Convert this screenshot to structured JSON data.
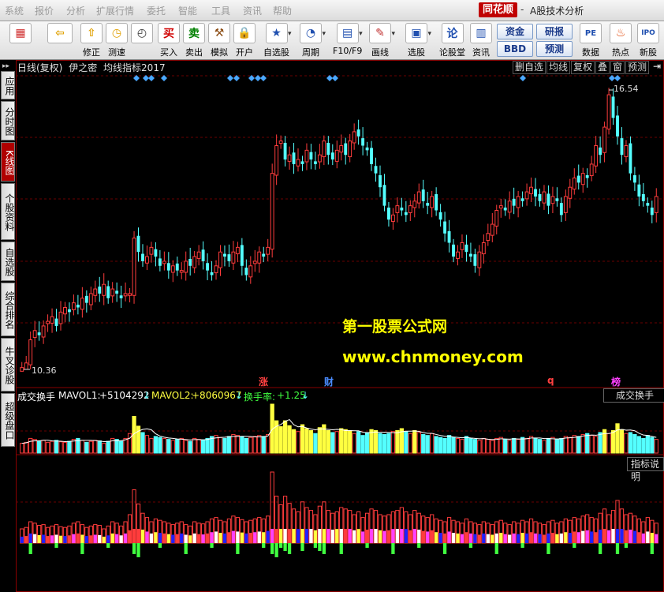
{
  "menu": [
    "系统",
    "报价",
    "分析",
    "扩展行情",
    "委托",
    "智能",
    "工具",
    "资讯",
    "帮助"
  ],
  "brand": "同花顺",
  "brand_dash": "-",
  "app_title": "A股技术分析",
  "toolbar": [
    {
      "label": "",
      "icon": "▦"
    },
    {
      "label": "",
      "icon": "⇦"
    },
    {
      "label": "修正",
      "icon": "⇧"
    },
    {
      "label": "测速",
      "icon": "◷"
    },
    {
      "label": "买入",
      "icon": "买"
    },
    {
      "label": "卖出",
      "icon": "卖"
    },
    {
      "label": "模拟",
      "icon": "⚒"
    },
    {
      "label": "开户",
      "icon": "🔒"
    },
    {
      "label": "自选股",
      "icon": "★"
    },
    {
      "label": "周期",
      "icon": "◔"
    },
    {
      "label": "F10/F9",
      "icon": "▤"
    },
    {
      "label": "画线",
      "icon": "✎"
    },
    {
      "label": "选股",
      "icon": "▣"
    },
    {
      "label": "论股堂",
      "icon": "论"
    },
    {
      "label": "资讯",
      "icon": "▥"
    },
    {
      "label": "数据",
      "icon": "PE"
    },
    {
      "label": "热点",
      "icon": "♨"
    },
    {
      "label": "新股",
      "icon": "IPO"
    }
  ],
  "toolbar_small": [
    "资金",
    "研报",
    "BBD",
    "预测"
  ],
  "sidebar": [
    "应用",
    "分时图",
    "K线图",
    "个股资料",
    "自选股",
    "综合排名",
    "牛叉诊股",
    "超级盘口"
  ],
  "chart_header": {
    "period": "日线(复权)",
    "stock": "伊之密",
    "indicator": "均线指标2017"
  },
  "top_buttons": [
    "删自选",
    "均线",
    "复权",
    "叠",
    "窗",
    "预测"
  ],
  "price_labels": {
    "high": "16.54",
    "low": "10.36"
  },
  "events": [
    {
      "label": "涨",
      "color": "#ff4040"
    },
    {
      "label": "财",
      "color": "#4a8cff"
    },
    {
      "label": "q",
      "color": "#ff4040"
    },
    {
      "label": "榜",
      "color": "#ff40ff"
    }
  ],
  "volume_panel": {
    "name": "成交换手",
    "mavol1_label": "MAVOL1:",
    "mavol1_value": "+5104292",
    "mavol1_arrow": "↓",
    "mavol2_label": "MAVOL2:",
    "mavol2_value": "+8060967",
    "mavol2_arrow": "↓",
    "turnover_label": "换手率:",
    "turnover_value": "+1.25",
    "turnover_arrow": "↓",
    "button": "成交换手"
  },
  "indicator_panel": {
    "button": "指标说明"
  },
  "watermark": {
    "line1": "第一股票公式网",
    "line2": "www.chnmoney.com"
  },
  "colors": {
    "up": "#ff3c3c",
    "down": "#54ffff",
    "vol_yellow": "#ffff40",
    "magenta": "#ff40ff",
    "blue": "#2020ff",
    "green": "#40ff40"
  },
  "chart_data": {
    "type": "candlestick",
    "price_high": 16.54,
    "price_low": 10.36,
    "close": [
      10.4,
      10.5,
      11.0,
      11.2,
      11.1,
      11.3,
      11.4,
      11.5,
      11.3,
      11.6,
      11.7,
      11.6,
      11.8,
      11.7,
      11.9,
      11.8,
      12.0,
      12.1,
      12.0,
      12.2,
      11.9,
      12.1,
      12.0,
      11.9,
      12.0,
      12.0,
      13.2,
      12.9,
      12.7,
      12.8,
      13.0,
      12.8,
      12.6,
      12.7,
      12.5,
      12.6,
      12.5,
      12.5,
      12.7,
      12.6,
      12.8,
      12.9,
      12.7,
      12.5,
      12.4,
      12.6,
      12.9,
      12.8,
      12.7,
      12.9,
      13.0,
      12.6,
      12.4,
      12.6,
      12.7,
      12.9,
      12.8,
      13.0,
      14.6,
      15.2,
      15.3,
      14.9,
      15.0,
      14.8,
      14.9,
      14.8,
      15.1,
      14.9,
      14.8,
      15.0,
      15.3,
      15.0,
      14.9,
      15.1,
      15.2,
      15.0,
      15.3,
      15.5,
      15.4,
      15.2,
      15.1,
      14.8,
      14.6,
      14.3,
      13.9,
      13.6,
      13.7,
      13.9,
      13.8,
      13.7,
      13.9,
      14.0,
      14.2,
      14.0,
      13.9,
      14.1,
      13.8,
      13.6,
      13.3,
      13.1,
      12.8,
      12.9,
      13.1,
      12.9,
      12.8,
      12.6,
      12.9,
      13.1,
      13.3,
      13.5,
      13.8,
      13.9,
      13.8,
      14.0,
      13.9,
      14.1,
      14.0,
      14.2,
      14.3,
      14.1,
      14.0,
      14.2,
      13.9,
      14.1,
      14.0,
      13.7,
      14.1,
      14.3,
      14.5,
      14.4,
      14.6,
      14.5,
      14.8,
      15.2,
      15.0,
      15.6,
      16.3,
      15.8,
      15.4,
      15.0,
      15.2,
      14.6,
      14.4,
      14.1,
      14.0,
      13.9,
      13.7,
      14.1
    ],
    "volume_ratio": [
      0.2,
      0.22,
      0.3,
      0.28,
      0.25,
      0.26,
      0.22,
      0.24,
      0.26,
      0.23,
      0.22,
      0.24,
      0.28,
      0.3,
      0.26,
      0.22,
      0.24,
      0.26,
      0.25,
      0.2,
      0.24,
      0.3,
      0.28,
      0.24,
      0.3,
      0.4,
      0.75,
      0.55,
      0.42,
      0.36,
      0.3,
      0.34,
      0.32,
      0.3,
      0.28,
      0.26,
      0.28,
      0.3,
      0.26,
      0.24,
      0.3,
      0.28,
      0.27,
      0.3,
      0.34,
      0.36,
      0.32,
      0.3,
      0.34,
      0.38,
      0.36,
      0.33,
      0.3,
      0.32,
      0.34,
      0.36,
      0.34,
      0.38,
      1.0,
      0.66,
      0.54,
      0.66,
      0.56,
      0.48,
      0.44,
      0.58,
      0.5,
      0.46,
      0.4,
      0.52,
      0.58,
      0.46,
      0.42,
      0.44,
      0.5,
      0.48,
      0.46,
      0.4,
      0.44,
      0.36,
      0.42,
      0.48,
      0.46,
      0.4,
      0.38,
      0.4,
      0.44,
      0.46,
      0.5,
      0.44,
      0.4,
      0.46,
      0.42,
      0.38,
      0.36,
      0.4,
      0.34,
      0.32,
      0.3,
      0.36,
      0.32,
      0.3,
      0.28,
      0.34,
      0.3,
      0.28,
      0.26,
      0.3,
      0.28,
      0.26,
      0.3,
      0.32,
      0.28,
      0.26,
      0.3,
      0.28,
      0.32,
      0.3,
      0.34,
      0.3,
      0.28,
      0.26,
      0.3,
      0.32,
      0.28,
      0.3,
      0.34,
      0.32,
      0.36,
      0.34,
      0.38,
      0.4,
      0.36,
      0.34,
      0.42,
      0.48,
      0.4,
      0.46,
      0.6,
      0.48,
      0.4,
      0.42,
      0.38,
      0.34,
      0.3,
      0.36,
      0.32,
      0.28,
      0.34,
      0.3,
      0.28,
      0.26
    ],
    "turnover_scale": "relative"
  }
}
